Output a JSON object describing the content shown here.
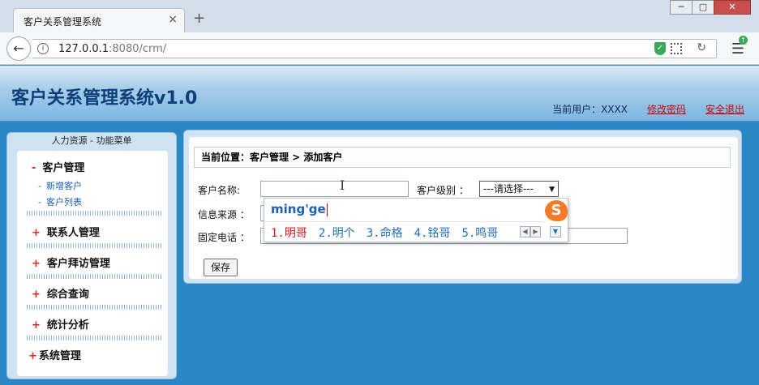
{
  "browser": {
    "tab_title": "客户关系管理系统",
    "tab_close": "×",
    "new_tab": "+",
    "url_host": "127.0.0.1",
    "url_rest": ":8080/crm/",
    "win_minimize": "─",
    "win_restore": "▢",
    "win_close": "✕"
  },
  "header": {
    "title": "客户关系管理系统v1.0",
    "current_user": "当前用户：XXXX",
    "change_password": "修改密码",
    "logout": "安全退出"
  },
  "sidebar": {
    "heading": "人力资源  - 功能菜单",
    "groups": [
      {
        "sign": "-",
        "label": "客户管理",
        "items": [
          "新增客户",
          "客户列表"
        ]
      },
      {
        "sign": "+",
        "label": "联系人管理"
      },
      {
        "sign": "+",
        "label": "客户拜访管理"
      },
      {
        "sign": "+",
        "label": "综合查询"
      },
      {
        "sign": "+",
        "label": "统计分析"
      },
      {
        "sign": "+",
        "label": "系统管理"
      }
    ],
    "sub_sign": "-"
  },
  "main": {
    "breadcrumb": "当前位置：客户管理 > 添加客户",
    "customer_name_label": "客户名称:",
    "customer_level_label": "客户级别 ：",
    "customer_level_value": "---请选择---",
    "source_label": "信息来源 ：",
    "phone_label": "固定电话 ：",
    "save_label": "保存"
  },
  "ime": {
    "composition": "ming'ge",
    "candidates": [
      "1.明哥",
      "2.明个",
      "3.命格",
      "4.铭哥",
      "5.鸣哥"
    ],
    "logo": "S"
  },
  "colors": {
    "page_bg": "#2b86c5",
    "title": "#0e3f78",
    "link_red": "#cc0000",
    "ime_selected": "#d21a1a",
    "ime_candidate": "#1f6fb5"
  }
}
